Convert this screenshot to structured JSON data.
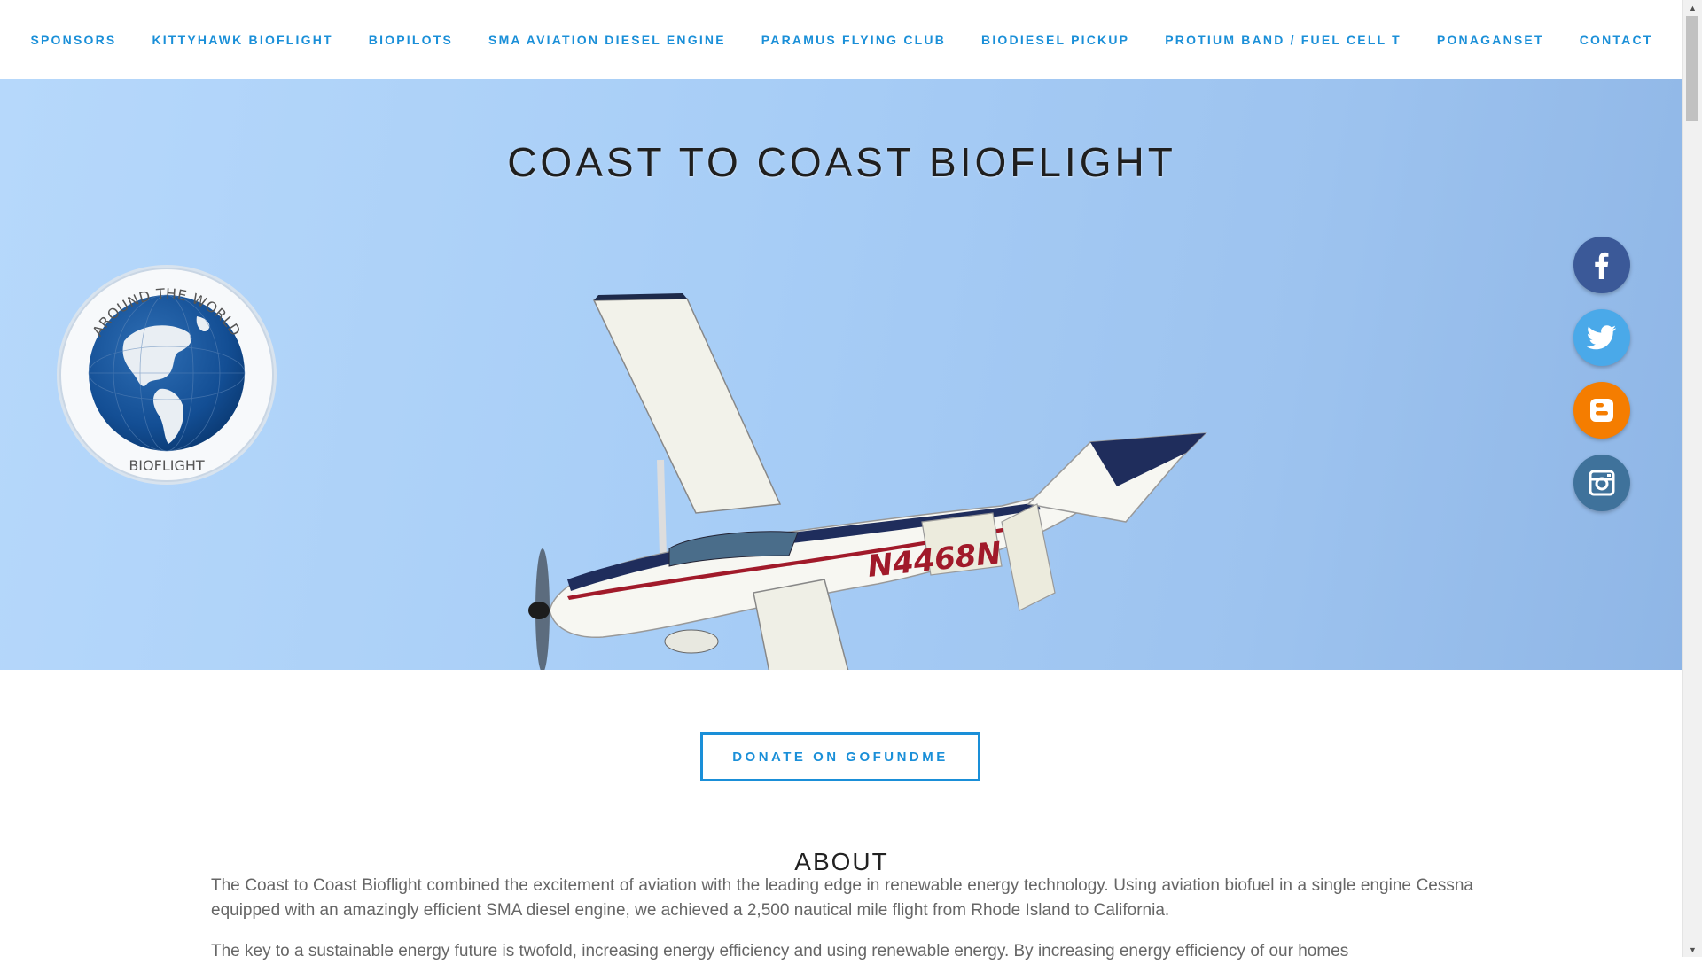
{
  "nav": {
    "items": [
      {
        "label": "SPONSORS"
      },
      {
        "label": "KITTYHAWK BIOFLIGHT"
      },
      {
        "label": "BIOPILOTS"
      },
      {
        "label": "SMA AVIATION DIESEL ENGINE"
      },
      {
        "label": "PARAMUS FLYING CLUB"
      },
      {
        "label": "BIODIESEL PICKUP"
      },
      {
        "label": "PROTIUM BAND / FUEL CELL T"
      },
      {
        "label": "PONAGANSET"
      },
      {
        "label": "CONTACT"
      }
    ]
  },
  "hero": {
    "title": "COAST TO COAST BIOFLIGHT",
    "badge": {
      "top_text": "AROUND THE WORLD",
      "bottom_text": "BIOFLIGHT"
    },
    "plane_registration": "N4468N"
  },
  "social": [
    {
      "name": "facebook",
      "icon": "facebook-icon",
      "color": "#3b5998"
    },
    {
      "name": "twitter",
      "icon": "twitter-icon",
      "color": "#4aa9e9"
    },
    {
      "name": "blogger",
      "icon": "blogger-icon",
      "color": "#f57d00"
    },
    {
      "name": "instagram",
      "icon": "instagram-icon",
      "color": "#3f729b"
    }
  ],
  "donate": {
    "label": "DONATE ON GOFUNDME"
  },
  "about": {
    "heading": "ABOUT",
    "paragraph1": "The Coast to Coast Bioflight combined the excitement of aviation with the leading edge in renewable energy technology. Using aviation biofuel in a single engine Cessna equipped with an amazingly efficient SMA diesel engine, we achieved a 2,500 nautical mile flight from Rhode Island to California.",
    "paragraph2": "The key to a sustainable energy future is twofold, increasing energy efficiency and using renewable energy. By increasing energy efficiency of our homes"
  },
  "colors": {
    "accent": "#1a8fd8",
    "sky": "#a7cdf6"
  }
}
